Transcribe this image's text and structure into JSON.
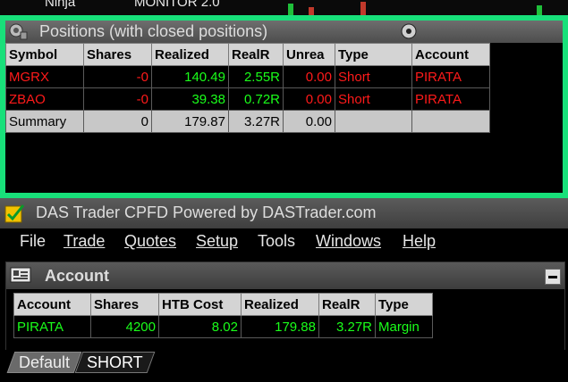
{
  "top_strip": {
    "left_text": "Ninja",
    "right_text": "MONITOR 2.0"
  },
  "positions_window": {
    "title": "Positions (with closed positions)",
    "columns": [
      "Symbol",
      "Shares",
      "Realized",
      "RealR",
      "Unrea",
      "Type",
      "Account"
    ],
    "rows": [
      {
        "symbol": "MGRX",
        "shares": "-0",
        "realized": "140.49",
        "realr": "2.55R",
        "unrealized": "0.00",
        "type": "Short",
        "account": "PIRATA"
      },
      {
        "symbol": "ZBAO",
        "shares": "-0",
        "realized": "39.38",
        "realr": "0.72R",
        "unrealized": "0.00",
        "type": "Short",
        "account": "PIRATA"
      }
    ],
    "summary": {
      "label": "Summary",
      "shares": "0",
      "realized": "179.87",
      "realr": "3.27R",
      "unrealized": "0.00",
      "type": "",
      "account": ""
    }
  },
  "das_window": {
    "title": "DAS Trader CPFD Powered by DASTrader.com",
    "menu": [
      "File",
      "Trade",
      "Quotes",
      "Setup",
      "Tools",
      "Windows",
      "Help"
    ],
    "account_panel": {
      "title": "Account",
      "columns": [
        "Account",
        "Shares",
        "HTB Cost",
        "Realized",
        "RealR",
        "Type"
      ],
      "row": {
        "account": "PIRATA",
        "shares": "4200",
        "htb_cost": "8.02",
        "realized": "179.88",
        "realr": "3.27R",
        "type": "Margin"
      }
    },
    "tabs": [
      "Default",
      "SHORT"
    ]
  },
  "colors": {
    "accent_border": "#18e07a",
    "negative": "#ff1a1a",
    "positive": "#1aff1a"
  }
}
